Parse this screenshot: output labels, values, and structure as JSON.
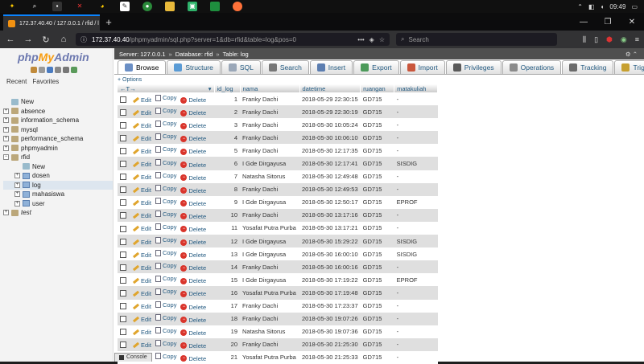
{
  "system_tray": {
    "time": "09:49"
  },
  "browser": {
    "tab_title": "172.37.40.40 / 127.0.0.1 / rfid / l",
    "url_host": "172.37.40.40",
    "url_path": "/phpmyadmin/sql.php?server=1&db=rfid&table=log&pos=0",
    "search_placeholder": "Search"
  },
  "pma": {
    "logo_php": "php",
    "logo_my": "My",
    "logo_admin": "Admin",
    "recent_label": "Recent",
    "favorites_label": "Favorites",
    "tree": [
      {
        "label": "New",
        "level": 0,
        "kind": "new"
      },
      {
        "label": "absence",
        "level": 0,
        "kind": "db"
      },
      {
        "label": "information_schema",
        "level": 0,
        "kind": "db"
      },
      {
        "label": "mysql",
        "level": 0,
        "kind": "db"
      },
      {
        "label": "performance_schema",
        "level": 0,
        "kind": "db"
      },
      {
        "label": "phpmyadmin",
        "level": 0,
        "kind": "db"
      },
      {
        "label": "rfid",
        "level": 0,
        "kind": "db-open"
      },
      {
        "label": "New",
        "level": 1,
        "kind": "new"
      },
      {
        "label": "dosen",
        "level": 1,
        "kind": "table"
      },
      {
        "label": "log",
        "level": 1,
        "kind": "table",
        "selected": true
      },
      {
        "label": "mahasiswa",
        "level": 1,
        "kind": "table"
      },
      {
        "label": "user",
        "level": 1,
        "kind": "table"
      },
      {
        "label": "test",
        "level": 0,
        "kind": "db-italic"
      }
    ],
    "breadcrumbs": [
      "Server: 127.0.0.1",
      "Database: rfid",
      "Table: log"
    ],
    "menu": [
      {
        "label": "Browse",
        "icon_color": "#6b8fc5",
        "active": true
      },
      {
        "label": "Structure",
        "icon_color": "#5a9bd5"
      },
      {
        "label": "SQL",
        "icon_color": "#9aa7b8"
      },
      {
        "label": "Search",
        "icon_color": "#777777"
      },
      {
        "label": "Insert",
        "icon_color": "#5b7db0"
      },
      {
        "label": "Export",
        "icon_color": "#4c9a5a"
      },
      {
        "label": "Import",
        "icon_color": "#c9563c"
      },
      {
        "label": "Privileges",
        "icon_color": "#5a5a5a"
      },
      {
        "label": "Operations",
        "icon_color": "#8a8a8a"
      },
      {
        "label": "Tracking",
        "icon_color": "#6a6a6a"
      },
      {
        "label": "Triggers",
        "icon_color": "#c7a030"
      }
    ],
    "options_link": "+ Options",
    "columns": [
      "id_log",
      "nama",
      "datetime",
      "ruangan",
      "matakuliah"
    ],
    "action_labels": {
      "edit": "Edit",
      "copy": "Copy",
      "delete": "Delete"
    },
    "rows": [
      [
        "1",
        "Franky Dachi",
        "2018-05-29 22:30:15",
        "GD715",
        "-"
      ],
      [
        "2",
        "Franky Dachi",
        "2018-05-29 22:30:19",
        "GD715",
        "-"
      ],
      [
        "3",
        "Franky Dachi",
        "2018-05-30 10:05:24",
        "GD715",
        "-"
      ],
      [
        "4",
        "Franky Dachi",
        "2018-05-30 10:06:10",
        "GD715",
        "-"
      ],
      [
        "5",
        "Franky Dachi",
        "2018-05-30 12:17:35",
        "GD715",
        "-"
      ],
      [
        "6",
        "I Gde Dirgayusa",
        "2018-05-30 12:17:41",
        "GD715",
        "SISDIG"
      ],
      [
        "7",
        "Natasha Sitorus",
        "2018-05-30 12:49:48",
        "GD715",
        "-"
      ],
      [
        "8",
        "Franky Dachi",
        "2018-05-30 12:49:53",
        "GD715",
        "-"
      ],
      [
        "9",
        "I Gde Dirgayusa",
        "2018-05-30 12:50:17",
        "GD715",
        "EPROF"
      ],
      [
        "10",
        "Franky Dachi",
        "2018-05-30 13:17:16",
        "GD715",
        "-"
      ],
      [
        "11",
        "Yosafat Putra Purba",
        "2018-05-30 13:17:21",
        "GD715",
        "-"
      ],
      [
        "12",
        "I Gde Dirgayusa",
        "2018-05-30 15:29:22",
        "GD715",
        "SISDIG"
      ],
      [
        "13",
        "I Gde Dirgayusa",
        "2018-05-30 16:00:10",
        "GD715",
        "SISDIG"
      ],
      [
        "14",
        "Franky Dachi",
        "2018-05-30 16:00:16",
        "GD715",
        "-"
      ],
      [
        "15",
        "I Gde Dirgayusa",
        "2018-05-30 17:19:22",
        "GD715",
        "EPROF"
      ],
      [
        "16",
        "Yosafat Putra Purba",
        "2018-05-30 17:19:48",
        "GD715",
        "-"
      ],
      [
        "17",
        "Franky Dachi",
        "2018-05-30 17:23:37",
        "GD715",
        "-"
      ],
      [
        "18",
        "Franky Dachi",
        "2018-05-30 19:07:26",
        "GD715",
        "-"
      ],
      [
        "19",
        "Natasha Sitorus",
        "2018-05-30 19:07:36",
        "GD715",
        "-"
      ],
      [
        "20",
        "Franky Dachi",
        "2018-05-30 21:25:30",
        "GD715",
        "-"
      ],
      [
        "21",
        "Yosafat Putra Purba",
        "2018-05-30 21:25:33",
        "GD715",
        "-"
      ]
    ],
    "console_label": "Console"
  }
}
